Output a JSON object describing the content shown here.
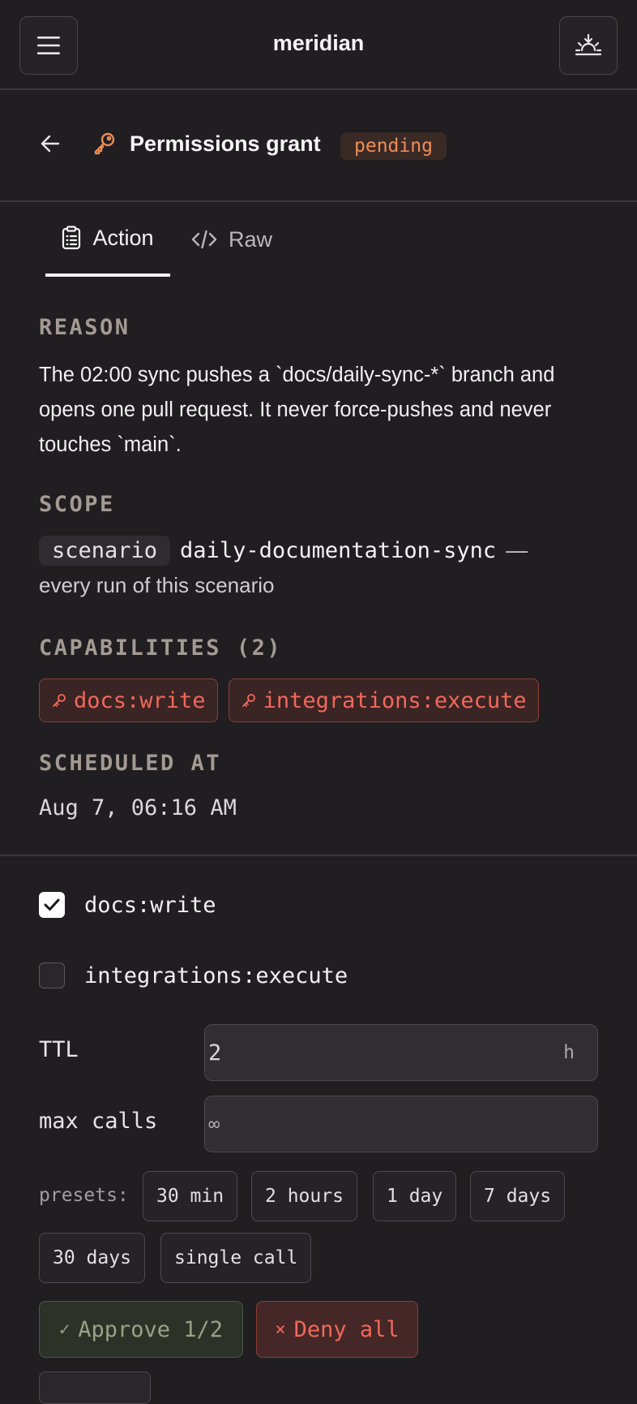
{
  "app": {
    "title": "meridian"
  },
  "header": {
    "title": "Permissions grant",
    "status": "pending"
  },
  "tabs": [
    {
      "label": "Action",
      "active": true
    },
    {
      "label": "Raw",
      "active": false
    }
  ],
  "reason": {
    "label": "REASON",
    "text": "The 02:00 sync pushes a `docs/daily-sync-*` branch and opens one pull request. It never force-pushes and never touches `main`."
  },
  "scope": {
    "label": "SCOPE",
    "kind": "scenario",
    "name": "daily-documentation-sync",
    "dash": "—",
    "description": "every run of this scenario"
  },
  "capabilities": {
    "label": "CAPABILITIES (2)",
    "items": [
      "docs:write",
      "integrations:execute"
    ]
  },
  "scheduled": {
    "label": "SCHEDULED AT",
    "value": "Aug 7, 06:16 AM"
  },
  "grants": [
    {
      "label": "docs:write",
      "checked": true
    },
    {
      "label": "integrations:execute",
      "checked": false
    }
  ],
  "ttl": {
    "label": "TTL",
    "value": "2",
    "unit": "h"
  },
  "max_calls": {
    "label": "max calls",
    "value": "∞"
  },
  "presets": {
    "label": "presets:",
    "items": [
      "30 min",
      "2 hours",
      "1 day",
      "7 days",
      "30 days",
      "single call"
    ]
  },
  "actions": {
    "approve_glyph": "✓",
    "approve": "Approve 1/2",
    "deny_glyph": "×",
    "deny": "Deny all"
  },
  "colors": {
    "background": "#201e21",
    "accent_orange": "#ef8d57",
    "capability_red": "#f2685a",
    "approve_green": "#96a384"
  }
}
